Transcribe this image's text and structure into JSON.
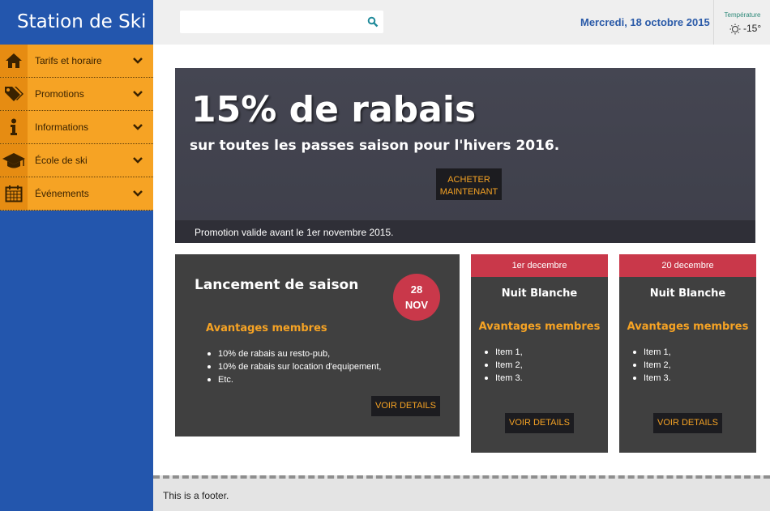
{
  "sidebar": {
    "brand": "Station de Ski",
    "items": [
      {
        "label": "Tarifs et horaire",
        "icon": "home-icon"
      },
      {
        "label": "Promotions",
        "icon": "tags-icon"
      },
      {
        "label": "Informations",
        "icon": "info-icon"
      },
      {
        "label": "École de ski",
        "icon": "graduation-cap-icon"
      },
      {
        "label": "Événements",
        "icon": "calendar-icon"
      }
    ]
  },
  "topbar": {
    "search": {
      "value": "",
      "placeholder": ""
    },
    "date": "Mercredi, 18 octobre 2015",
    "temperature": {
      "title": "Température",
      "value": "-15°",
      "icon": "sun-icon"
    }
  },
  "hero": {
    "title": "15% de rabais",
    "subtitle": "sur toutes les passes saison pour l'hivers 2016.",
    "button_line1": "ACHETER",
    "button_line2": "MAINTENANT",
    "footer_note": "Promotion valide avant le 1er novembre 2015."
  },
  "main_card": {
    "title": "Lancement de saison",
    "date_day": "28",
    "date_month": "NOV",
    "section_title": "Avantages membres",
    "items": [
      "10% de rabais au resto-pub,",
      "10% de rabais sur location d'equipement,",
      "Etc."
    ],
    "button": "VOIR DETAILS"
  },
  "event_cards": [
    {
      "date": "1er decembre",
      "title": "Nuit Blanche",
      "section_title": "Avantages membres",
      "items": [
        "Item 1,",
        "Item 2,",
        "Item 3."
      ],
      "button": "VOIR DETAILS"
    },
    {
      "date": "20 decembre",
      "title": "Nuit Blanche",
      "section_title": "Avantages membres",
      "items": [
        "Item 1,",
        "Item 2,",
        "Item 3."
      ],
      "button": "VOIR DETAILS"
    }
  ],
  "footer": {
    "text": "This is a footer."
  },
  "colors": {
    "sidebar": "#2356ad",
    "menu": "#f6a324",
    "accent": "#c9384a",
    "card": "#404040",
    "hero": "#434450"
  }
}
